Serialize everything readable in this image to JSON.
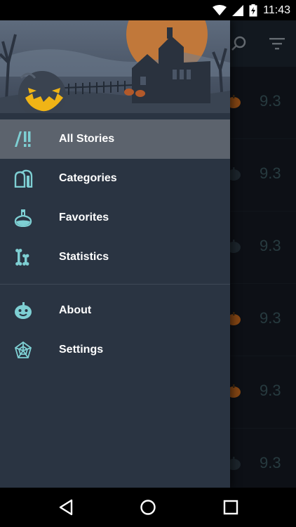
{
  "status_bar": {
    "time": "11:43",
    "icons": [
      "wifi-icon",
      "signal-icon",
      "battery-charging-icon"
    ]
  },
  "background_app": {
    "toolbar_icons": [
      "search-icon",
      "filter-icon"
    ],
    "rows": [
      {
        "rating": "9.3",
        "icon": "pumpkin-icon"
      },
      {
        "rating": "9.3",
        "icon": "pumpkin-icon"
      },
      {
        "rating": "9.3",
        "icon": "pumpkin-icon"
      },
      {
        "rating": "9.3",
        "icon": "pumpkin-icon"
      },
      {
        "rating": "9.3",
        "icon": "pumpkin-icon"
      },
      {
        "rating": "9.3",
        "icon": "pumpkin-icon"
      }
    ]
  },
  "drawer": {
    "header_image": "haunted-house-pumpkin-illustration",
    "primary_items": [
      {
        "label": "All Stories",
        "icon": "books-icon",
        "selected": true
      },
      {
        "label": "Categories",
        "icon": "tombstone-icon",
        "selected": false
      },
      {
        "label": "Favorites",
        "icon": "potion-icon",
        "selected": false
      },
      {
        "label": "Statistics",
        "icon": "bones-icon",
        "selected": false
      }
    ],
    "secondary_items": [
      {
        "label": "About",
        "icon": "pumpkin-face-icon",
        "selected": false
      },
      {
        "label": "Settings",
        "icon": "spiderweb-icon",
        "selected": false
      }
    ]
  },
  "nav_bar": {
    "buttons": [
      "back-icon",
      "home-icon",
      "recents-icon"
    ]
  },
  "colors": {
    "accent": "#7ecfd3",
    "drawer_bg": "#2a3442",
    "selected_bg": "#5c636d",
    "app_bg": "#141a23",
    "rating_text": "#3d5a61"
  }
}
